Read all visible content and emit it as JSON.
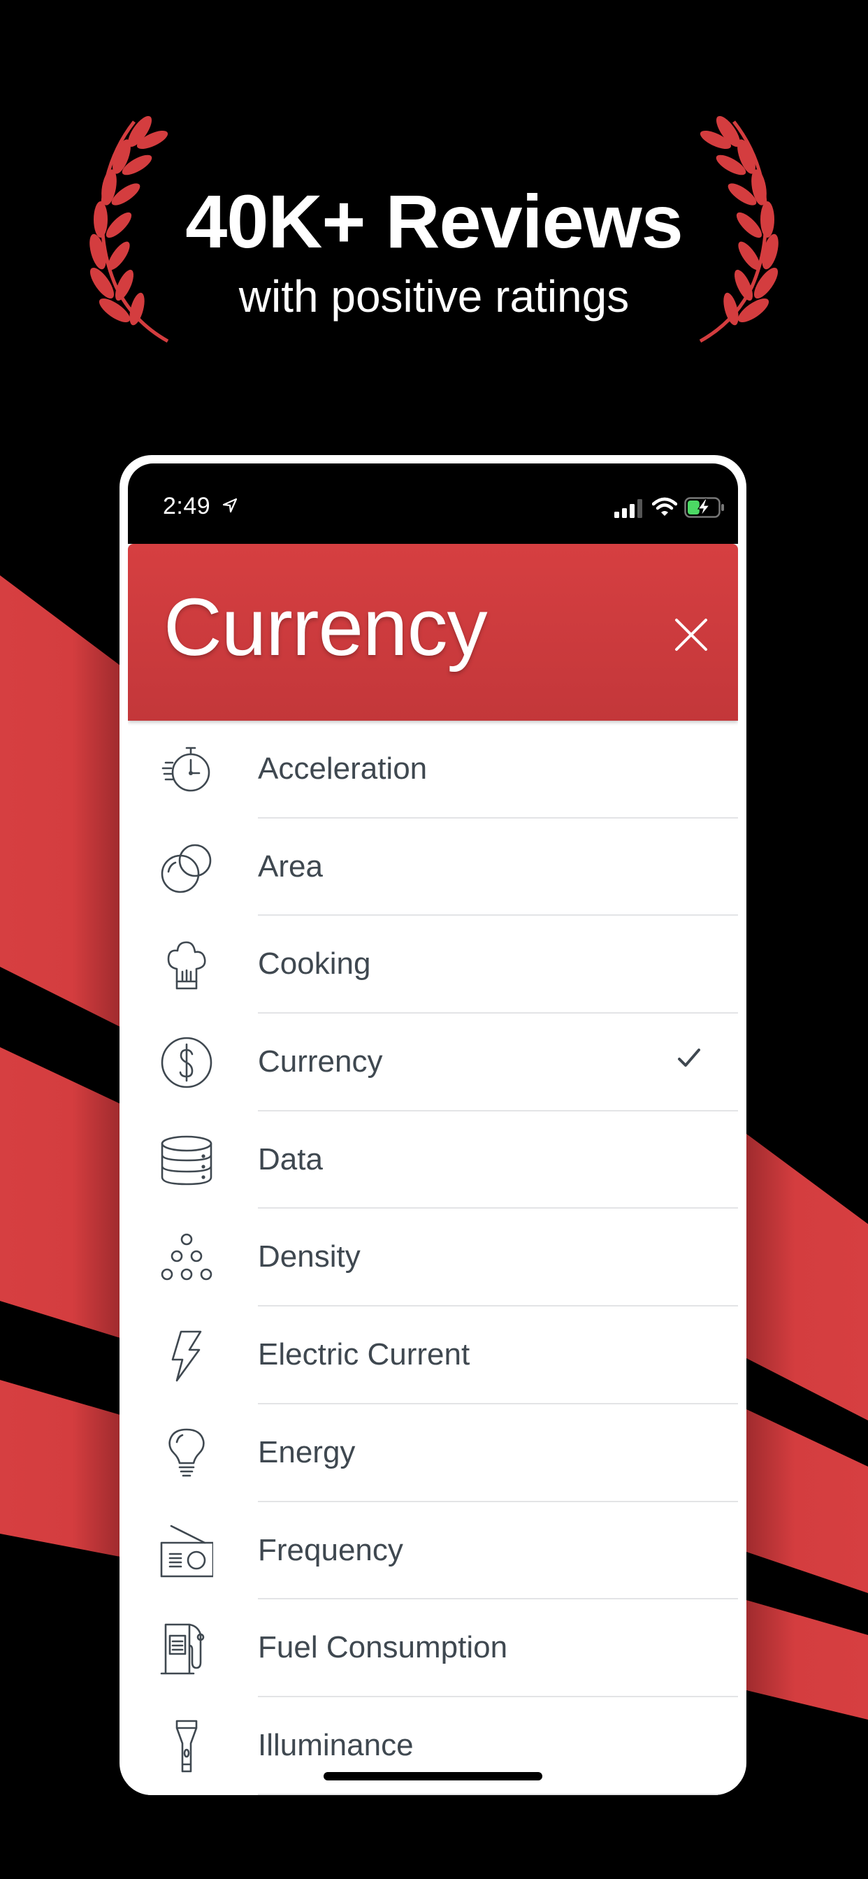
{
  "promo": {
    "headline": "40K+ Reviews",
    "subheadline": "with positive ratings"
  },
  "colors": {
    "brand_red": "#d43d3f",
    "background": "#000000",
    "list_text": "#3f4850",
    "separator": "#e3e4e6",
    "battery_green": "#4cd964"
  },
  "status_bar": {
    "time": "2:49",
    "location_icon": "location-arrow-icon",
    "signal_bars_active": 3,
    "signal_bars_total": 4,
    "wifi_icon": "wifi-icon",
    "battery_level": 0.4,
    "battery_charging": true
  },
  "sheet": {
    "title": "Currency",
    "close_icon": "close-icon"
  },
  "categories": [
    {
      "label": "Acceleration",
      "icon": "stopwatch-icon",
      "selected": false
    },
    {
      "label": "Area",
      "icon": "overlapping-circles-icon",
      "selected": false
    },
    {
      "label": "Cooking",
      "icon": "chef-hat-icon",
      "selected": false
    },
    {
      "label": "Currency",
      "icon": "dollar-coin-icon",
      "selected": true
    },
    {
      "label": "Data",
      "icon": "database-icon",
      "selected": false
    },
    {
      "label": "Density",
      "icon": "stacked-circles-icon",
      "selected": false
    },
    {
      "label": "Electric Current",
      "icon": "lightning-bolt-icon",
      "selected": false
    },
    {
      "label": "Energy",
      "icon": "light-bulb-icon",
      "selected": false
    },
    {
      "label": "Frequency",
      "icon": "radio-icon",
      "selected": false
    },
    {
      "label": "Fuel Consumption",
      "icon": "fuel-pump-icon",
      "selected": false
    },
    {
      "label": "Illuminance",
      "icon": "flashlight-icon",
      "selected": false
    }
  ]
}
